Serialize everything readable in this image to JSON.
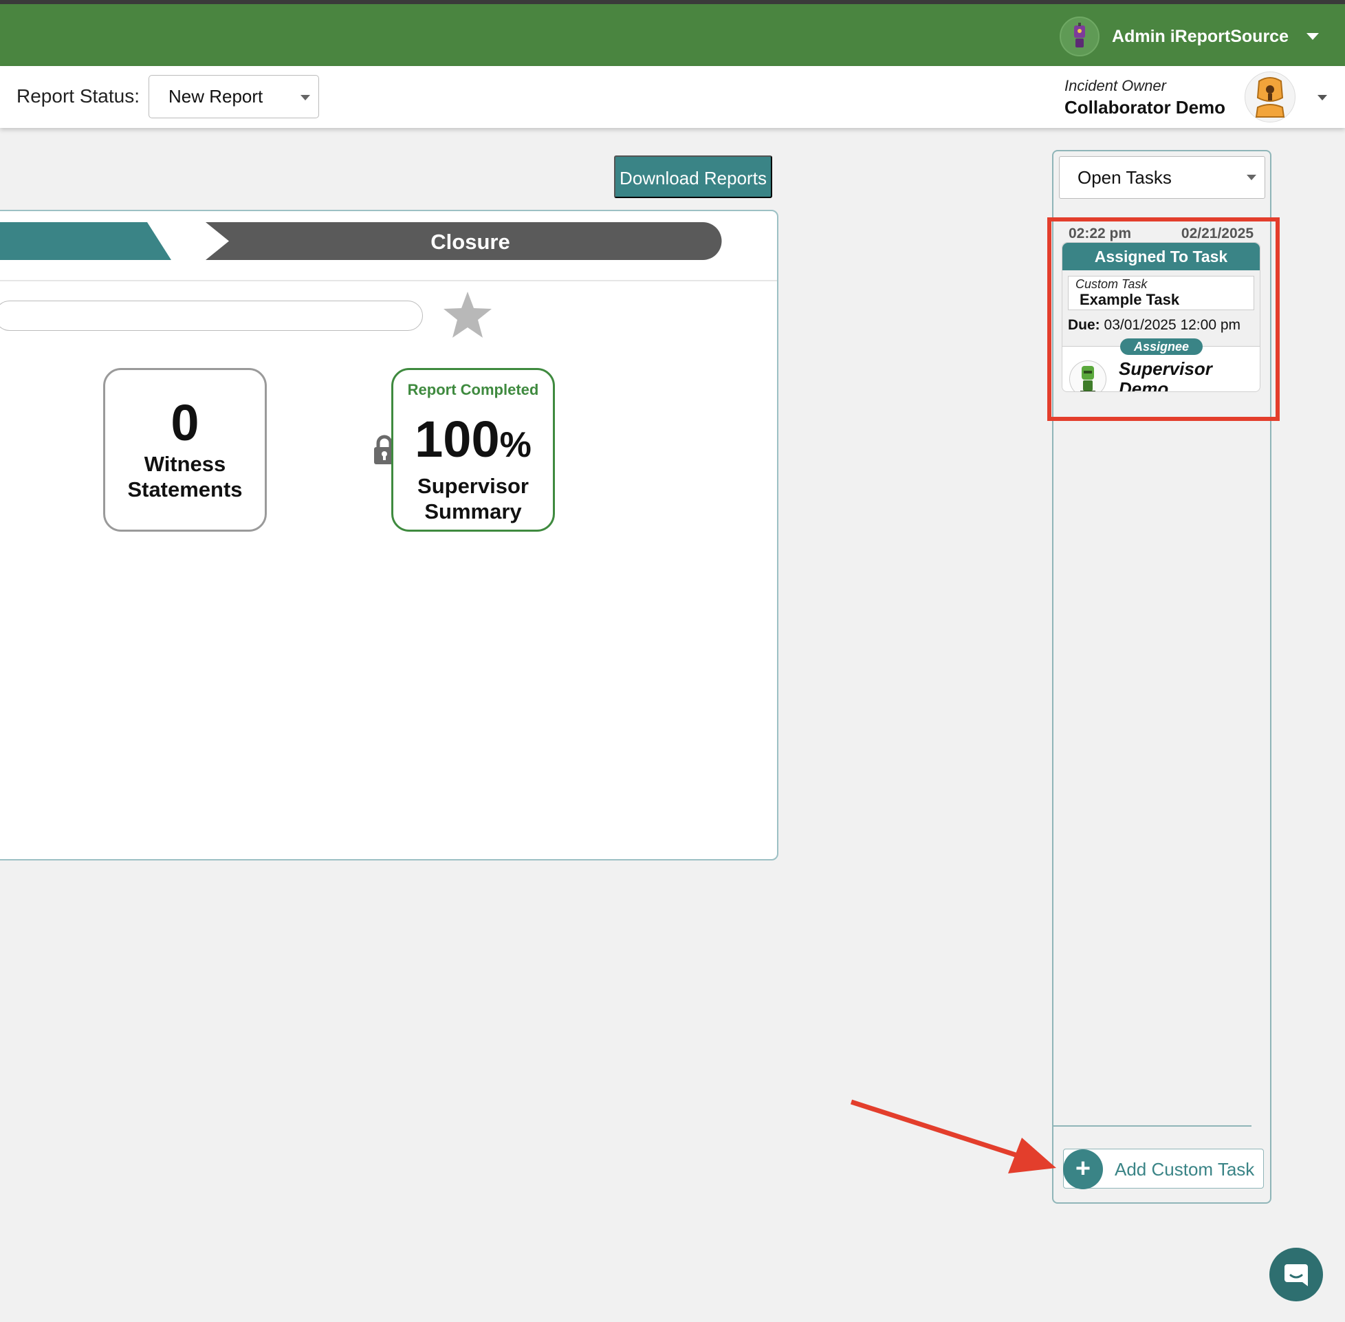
{
  "topbar": {
    "user_name": "Admin iReportSource",
    "user_icon": "robot-avatar-icon",
    "menu_icon": "chevron-down-icon",
    "brand_color": "#4a8540"
  },
  "status_bar": {
    "label": "Report Status:",
    "selected": "New Report",
    "owner_caption": "Incident Owner",
    "owner_name": "Collaborator Demo",
    "owner_icon": "robot-avatar-icon"
  },
  "actions": {
    "download_label": "Download Reports"
  },
  "stages": {
    "closure_label": "Closure",
    "active_color": "#3a8486",
    "inactive_color": "#5a5a5a"
  },
  "tiles": {
    "witness_count": "0",
    "witness_label": "Witness Statements",
    "summary_status": "Report Completed",
    "summary_percent": "100",
    "summary_percent_sign": "%",
    "summary_label": "Supervisor Summary",
    "star_icon": "star-icon",
    "lock_icon": "lock-icon"
  },
  "tasks": {
    "filter_selected": "Open Tasks",
    "items": [
      {
        "time": "02:22 pm",
        "date": "02/21/2025",
        "status": "Assigned To Task",
        "type": "Custom Task",
        "name": "Example Task",
        "due_label": "Due:",
        "due_value": "03/01/2025 12:00 pm",
        "assignee_label": "Assignee",
        "assignee_name": "Supervisor Demo"
      }
    ],
    "add_label": "Add Custom Task",
    "add_icon": "plus-icon"
  },
  "chat": {
    "icon": "chat-bubble-icon"
  },
  "annotation_color": "#e33e2c"
}
